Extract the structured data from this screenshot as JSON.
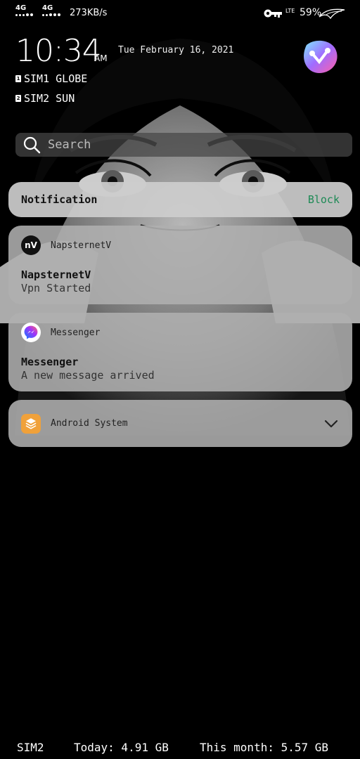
{
  "status_bar": {
    "sim1_network": "4G",
    "sim2_network": "4G",
    "net_speed": "273KB/s",
    "lte_label": "LTE",
    "battery": "59%",
    "icons": [
      "signal-sim1",
      "signal-sim2",
      "vpn-key-icon",
      "battery-icon",
      "rog-logo-icon"
    ]
  },
  "lockinfo": {
    "time": "10:34",
    "ampm": "AM",
    "date": "Tue February 16, 2021",
    "sim1": "SIM1 GLOBE",
    "sim2": "SIM2 SUN",
    "sim1_badge": "1",
    "sim2_badge": "2"
  },
  "search": {
    "placeholder": "Search"
  },
  "notification_header": {
    "title": "Notification",
    "block_label": "Block"
  },
  "notifications": [
    {
      "app": "NapsternetV",
      "icon_text": "nV",
      "title": "NapsternetV",
      "text": "Vpn Started"
    },
    {
      "app": "Messenger",
      "title": "Messenger",
      "text": "A new message arrived"
    },
    {
      "app": "Android System",
      "collapsed": true
    }
  ],
  "footer": {
    "sim": "SIM2",
    "today": "Today: 4.91 GB",
    "month": "This month: 5.57 GB"
  },
  "colors": {
    "block": "#1d8a55",
    "card": "#afafaf",
    "background": "#000000"
  }
}
